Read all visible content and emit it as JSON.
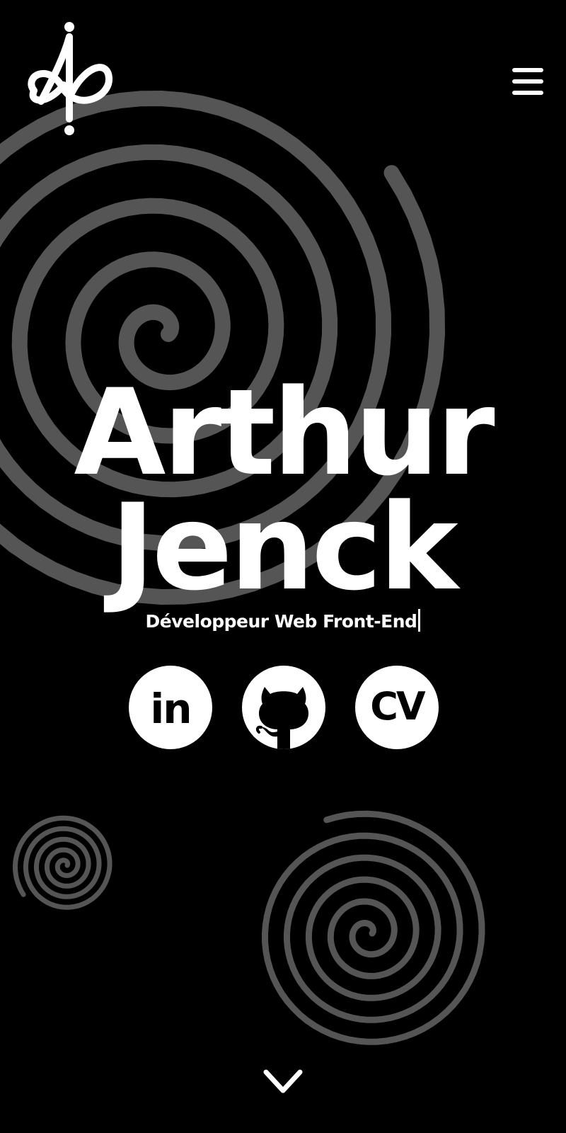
{
  "header": {
    "logo_icon": "ajs-monogram-logo",
    "menu_icon": "hamburger-menu-icon"
  },
  "hero": {
    "first_name": "Arthur",
    "last_name": "Jenck",
    "subtitle": "Développeur Web Front-End"
  },
  "social": [
    {
      "name": "linkedin",
      "label": "in",
      "icon": "linkedin-icon"
    },
    {
      "name": "github",
      "label": "",
      "icon": "github-icon"
    },
    {
      "name": "cv",
      "label": "CV",
      "icon": "cv-icon"
    }
  ],
  "scroll": {
    "icon": "chevron-down-icon"
  },
  "colors": {
    "background": "#000000",
    "foreground": "#ffffff",
    "spiral": "#555555"
  }
}
